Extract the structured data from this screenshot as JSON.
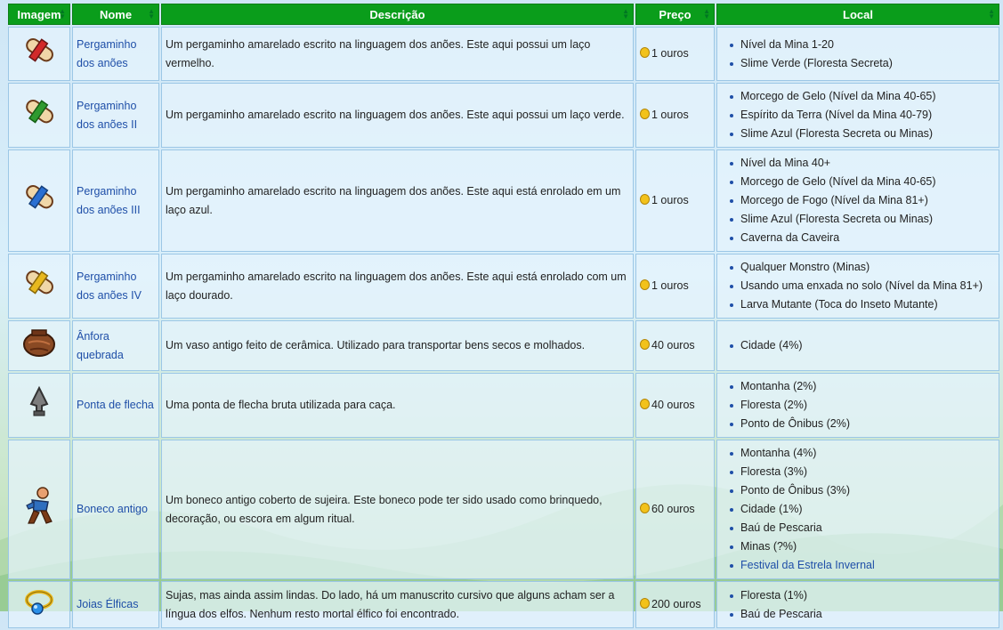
{
  "headers": {
    "image": "Imagem",
    "name": "Nome",
    "description": "Descrição",
    "price": "Preço",
    "location": "Local"
  },
  "rows": [
    {
      "icon": "red-scroll-icon",
      "name": "Pergaminho dos anões",
      "description": "Um pergaminho amarelado escrito na linguagem dos anões. Este aqui possui um laço vermelho.",
      "price": "1 ouros",
      "locations": [
        "Nível da Mina 1-20",
        "Slime Verde (Floresta Secreta)"
      ]
    },
    {
      "icon": "green-scroll-icon",
      "name": "Pergaminho dos anões II",
      "description": "Um pergaminho amarelado escrito na linguagem dos anões. Este aqui possui um laço verde.",
      "price": "1 ouros",
      "locations": [
        "Morcego de Gelo (Nível da Mina 40-65)",
        "Espírito da Terra (Nível da Mina 40-79)",
        "Slime Azul (Floresta Secreta ou Minas)"
      ]
    },
    {
      "icon": "blue-scroll-icon",
      "name": "Pergaminho dos anões III",
      "description": "Um pergaminho amarelado escrito na linguagem dos anões. Este aqui está enrolado em um laço azul.",
      "price": "1 ouros",
      "locations": [
        "Nível da Mina 40+",
        "Morcego de Gelo (Nível da Mina 40-65)",
        "Morcego de Fogo (Nível da Mina 81+)",
        "Slime Azul (Floresta Secreta ou Minas)",
        "Caverna da Caveira"
      ]
    },
    {
      "icon": "gold-scroll-icon",
      "name": "Pergaminho dos anões IV",
      "description": "Um pergaminho amarelado escrito na linguagem dos anões. Este aqui está enrolado com um laço dourado.",
      "price": "1 ouros",
      "locations": [
        "Qualquer Monstro (Minas)",
        "Usando uma enxada no solo (Nível da Mina 81+)",
        "Larva Mutante (Toca do Inseto Mutante)"
      ]
    },
    {
      "icon": "broken-amphora-icon",
      "name": "Ânfora quebrada",
      "description": "Um vaso antigo feito de cerâmica. Utilizado para transportar bens secos e molhados.",
      "price": "40 ouros",
      "locations": [
        "Cidade (4%)"
      ]
    },
    {
      "icon": "arrowhead-icon",
      "name": "Ponta de flecha",
      "description": "Uma ponta de flecha bruta utilizada para caça.",
      "price": "40 ouros",
      "locations": [
        "Montanha (2%)",
        "Floresta (2%)",
        "Ponto de Ônibus (2%)"
      ]
    },
    {
      "icon": "ancient-doll-icon",
      "name": "Boneco antigo",
      "description": "Um boneco antigo coberto de sujeira. Este boneco pode ter sido usado como brinquedo, decoração, ou escora em algum ritual.",
      "price": "60 ouros",
      "locations": [
        "Montanha (4%)",
        "Floresta (3%)",
        "Ponto de Ônibus (3%)",
        "Cidade (1%)",
        "Baú de Pescaria",
        "Minas (?%)",
        "Festival da Estrela Invernal"
      ]
    },
    {
      "icon": "elvish-jewelry-icon",
      "name": "Joias Élficas",
      "description": "Sujas, mas ainda assim lindas. Do lado, há um manuscrito cursivo que alguns acham ser a língua dos elfos. Nenhum resto mortal élfico foi encontrado.",
      "price": "200 ouros",
      "locations": [
        "Floresta (1%)",
        "Baú de Pescaria"
      ]
    }
  ]
}
